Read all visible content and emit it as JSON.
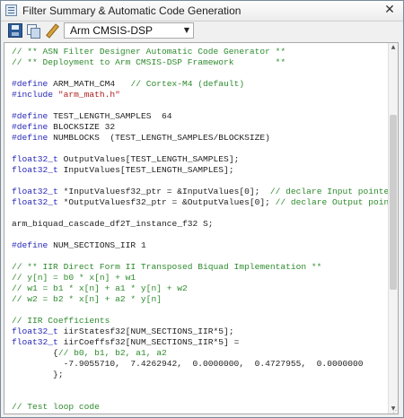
{
  "window": {
    "title": "Filter Summary & Automatic Code Generation",
    "close_symbol": "✕"
  },
  "toolbar": {
    "icons": [
      "save-icon",
      "copy-icon",
      "edit-icon"
    ],
    "target_dropdown": {
      "selected": "Arm CMSIS-DSP",
      "arrow": "▼"
    }
  },
  "editor": {
    "lines": [
      {
        "segments": [
          {
            "cls": "c-comment",
            "t": "// ** ASN Filter Designer Automatic Code Generator **"
          }
        ]
      },
      {
        "segments": [
          {
            "cls": "c-comment",
            "t": "// ** Deployment to Arm CMSIS-DSP Framework        **"
          }
        ]
      },
      {
        "segments": [
          {
            "cls": "c-text",
            "t": ""
          }
        ]
      },
      {
        "segments": [
          {
            "cls": "c-directive",
            "t": "#define"
          },
          {
            "cls": "c-text",
            "t": " ARM_MATH_CM4   "
          },
          {
            "cls": "c-comment",
            "t": "// Cortex-M4 (default)"
          }
        ]
      },
      {
        "segments": [
          {
            "cls": "c-directive",
            "t": "#include"
          },
          {
            "cls": "c-text",
            "t": " "
          },
          {
            "cls": "c-string",
            "t": "\"arm_math.h\""
          }
        ]
      },
      {
        "segments": [
          {
            "cls": "c-text",
            "t": ""
          }
        ]
      },
      {
        "segments": [
          {
            "cls": "c-directive",
            "t": "#define"
          },
          {
            "cls": "c-text",
            "t": " TEST_LENGTH_SAMPLES  64"
          }
        ]
      },
      {
        "segments": [
          {
            "cls": "c-directive",
            "t": "#define"
          },
          {
            "cls": "c-text",
            "t": " BLOCKSIZE 32"
          }
        ]
      },
      {
        "segments": [
          {
            "cls": "c-directive",
            "t": "#define"
          },
          {
            "cls": "c-text",
            "t": " NUMBLOCKS  (TEST_LENGTH_SAMPLES/BLOCKSIZE)"
          }
        ]
      },
      {
        "segments": [
          {
            "cls": "c-text",
            "t": ""
          }
        ]
      },
      {
        "segments": [
          {
            "cls": "c-type",
            "t": "float32_t"
          },
          {
            "cls": "c-text",
            "t": " OutputValues[TEST_LENGTH_SAMPLES];"
          }
        ]
      },
      {
        "segments": [
          {
            "cls": "c-type",
            "t": "float32_t"
          },
          {
            "cls": "c-text",
            "t": " InputValues[TEST_LENGTH_SAMPLES];"
          }
        ]
      },
      {
        "segments": [
          {
            "cls": "c-text",
            "t": ""
          }
        ]
      },
      {
        "segments": [
          {
            "cls": "c-type",
            "t": "float32_t"
          },
          {
            "cls": "c-text",
            "t": " *InputValuesf32_ptr = &InputValues[0];  "
          },
          {
            "cls": "c-comment",
            "t": "// declare Input pointe"
          }
        ]
      },
      {
        "segments": [
          {
            "cls": "c-type",
            "t": "float32_t"
          },
          {
            "cls": "c-text",
            "t": " *OutputValuesf32_ptr = &OutputValues[0]; "
          },
          {
            "cls": "c-comment",
            "t": "// declare Output poin"
          }
        ]
      },
      {
        "segments": [
          {
            "cls": "c-text",
            "t": ""
          }
        ]
      },
      {
        "segments": [
          {
            "cls": "c-text",
            "t": "arm_biquad_cascade_df2T_instance_f32 S;"
          }
        ]
      },
      {
        "segments": [
          {
            "cls": "c-text",
            "t": ""
          }
        ]
      },
      {
        "segments": [
          {
            "cls": "c-directive",
            "t": "#define"
          },
          {
            "cls": "c-text",
            "t": " NUM_SECTIONS_IIR 1"
          }
        ]
      },
      {
        "segments": [
          {
            "cls": "c-text",
            "t": ""
          }
        ]
      },
      {
        "segments": [
          {
            "cls": "c-comment",
            "t": "// ** IIR Direct Form II Transposed Biquad Implementation **"
          }
        ]
      },
      {
        "segments": [
          {
            "cls": "c-comment",
            "t": "// y[n] = b0 * x[n] + w1"
          }
        ]
      },
      {
        "segments": [
          {
            "cls": "c-comment",
            "t": "// w1 = b1 * x[n] + a1 * y[n] + w2"
          }
        ]
      },
      {
        "segments": [
          {
            "cls": "c-comment",
            "t": "// w2 = b2 * x[n] + a2 * y[n]"
          }
        ]
      },
      {
        "segments": [
          {
            "cls": "c-text",
            "t": ""
          }
        ]
      },
      {
        "segments": [
          {
            "cls": "c-comment",
            "t": "// IIR Coefficients"
          }
        ]
      },
      {
        "segments": [
          {
            "cls": "c-type",
            "t": "float32_t"
          },
          {
            "cls": "c-text",
            "t": " iirStatesf32[NUM_SECTIONS_IIR*5];"
          }
        ]
      },
      {
        "segments": [
          {
            "cls": "c-type",
            "t": "float32_t"
          },
          {
            "cls": "c-text",
            "t": " iirCoeffsf32[NUM_SECTIONS_IIR*5] ="
          }
        ]
      },
      {
        "segments": [
          {
            "cls": "c-text",
            "t": "        {"
          },
          {
            "cls": "c-comment",
            "t": "// b0, b1, b2, a1, a2"
          }
        ]
      },
      {
        "segments": [
          {
            "cls": "c-text",
            "t": "          -7.9055710,  7.4262942,  0.0000000,  0.4727955,  0.0000000"
          }
        ]
      },
      {
        "segments": [
          {
            "cls": "c-text",
            "t": "        };"
          }
        ]
      },
      {
        "segments": [
          {
            "cls": "c-text",
            "t": ""
          }
        ]
      },
      {
        "segments": [
          {
            "cls": "c-text",
            "t": ""
          }
        ]
      },
      {
        "segments": [
          {
            "cls": "c-comment",
            "t": "// Test loop code"
          }
        ]
      }
    ]
  }
}
